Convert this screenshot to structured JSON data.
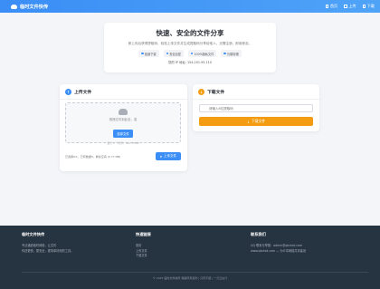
{
  "nav": {
    "brand": "临时文件快传",
    "links": [
      {
        "label": "首页",
        "icon": "home-icon"
      },
      {
        "label": "上传",
        "icon": "upload-icon"
      },
      {
        "label": "下载",
        "icon": "download-icon"
      }
    ]
  },
  "hero": {
    "title": "快速、安全的文件分享",
    "subtitle": "即上传后获得提取码，轻松上传文件并生成提取码分享给他人，无需注册，即用即走。",
    "features": [
      "极速下载",
      "安全加密",
      "100%隐私文件",
      "长期存储"
    ],
    "ip": "您的 IP 地址: 154.201.95.110"
  },
  "upload": {
    "title": "上传文件",
    "dropzone_text": "拖拽文件到此处，或",
    "choose_label": "选择文件",
    "limit": "最大 1 个文件，Max 50MB",
    "status": "已选择0/1，已有数据0，剩余空间 (0.77 MB)",
    "button_label": "上传文件"
  },
  "download": {
    "title": "下载文件",
    "input_placeholder": "请输入6位提取码",
    "button_label": "下载文件"
  },
  "footer": {
    "col1_title": "临时文件快传",
    "col1_text": [
      "专业通道临时网络，让文件",
      "传送更快，更安全，更简单好用的工具。"
    ],
    "col2_title": "快速链接",
    "col2_links": [
      "首页",
      "上传文件",
      "下载文件"
    ],
    "col3_title": "联系我们",
    "col3_lines": [
      "QQ 联系与举报：admin@qkctxd.com",
      "www.qkctxd.com — 为众享网络共享建设"
    ],
    "copyright": "© 2025 临时文件快传 保留所有权利 | 只传不留 | 一元云在计"
  },
  "colors": {
    "primary": "#3a8ef6",
    "accent": "#f39c12",
    "footer": "#263340"
  }
}
